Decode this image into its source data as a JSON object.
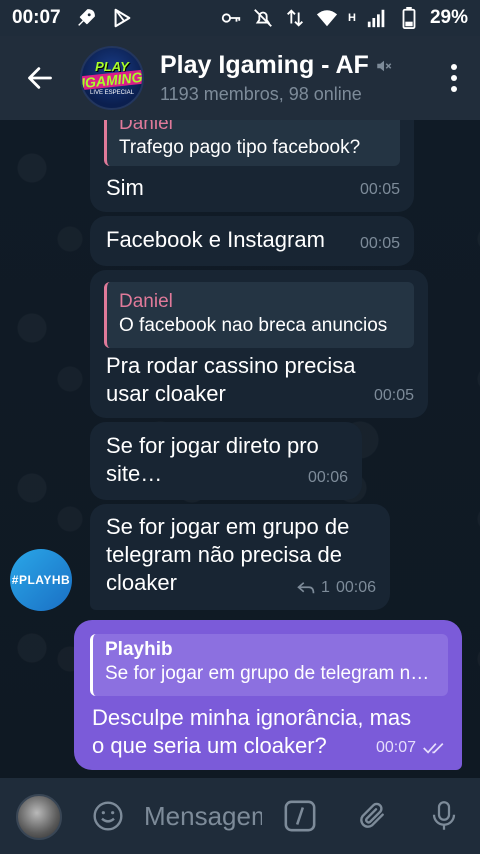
{
  "status": {
    "time": "00:07",
    "network": "H",
    "battery": "29%"
  },
  "header": {
    "title": "Play Igaming - AF",
    "subtitle": "1193 membros, 98 online",
    "avatar_line1": "PLAY",
    "avatar_line2": "IGAMING",
    "avatar_line3": "LIVE ESPECIAL"
  },
  "messages": [
    {
      "reply_name": "Daniel",
      "reply_text": "Trafego pago tipo facebook?",
      "text": "Sim",
      "time": "00:05"
    },
    {
      "text": "Facebook e Instagram",
      "time": "00:05"
    },
    {
      "reply_name": "Daniel",
      "reply_text": "O facebook nao breca anuncios",
      "text_line1": "Pra rodar cassino precisa",
      "text_line2": "usar cloaker",
      "time": "00:05"
    },
    {
      "text_line1": "Se for jogar direto pro",
      "text_line2": "site…",
      "time": "00:06"
    },
    {
      "text_line1": "Se for jogar em grupo de",
      "text_line2": "telegram não precisa de",
      "text_line3": "cloaker",
      "reply_count": "1",
      "time": "00:06"
    }
  ],
  "sender_avatar": "#PLAYHB",
  "outgoing": {
    "reply_name": "Playhib",
    "reply_text": "Se for jogar em grupo de telegram não precisa de cloaker",
    "text_line1": "Desculpe minha ignorância, mas",
    "text_line2": "o que seria um cloaker?",
    "time": "00:07"
  },
  "input": {
    "placeholder": "Mensagem"
  },
  "colors": {
    "outgoing_bubble": "#7b5bd9",
    "incoming_bubble": "#182533",
    "reply_accent": "#e07a9a"
  }
}
